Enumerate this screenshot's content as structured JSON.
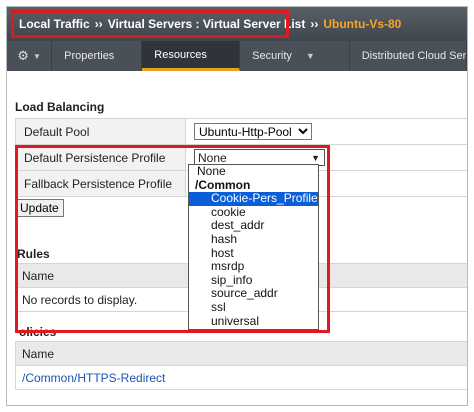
{
  "breadcrumb": {
    "items": [
      "Local Traffic",
      "Virtual Servers : Virtual Server List",
      "Ubuntu-Vs-80"
    ],
    "separator": "››"
  },
  "tabs": [
    {
      "label": "Properties",
      "active": false,
      "has_menu": false
    },
    {
      "label": "Resources",
      "active": true,
      "has_menu": false
    },
    {
      "label": "Security",
      "active": false,
      "has_menu": true
    },
    {
      "label": "Distributed Cloud Ser",
      "active": false,
      "has_menu": false
    }
  ],
  "load_balancing": {
    "title": "Load Balancing",
    "default_pool_label": "Default Pool",
    "default_pool_value": "Ubuntu-Http-Pool",
    "persistence_label": "Default Persistence Profile",
    "persistence_value": "None",
    "fallback_label": "Fallback Persistence Profile",
    "update_label": "Update"
  },
  "persistence_dropdown": {
    "options": [
      {
        "label": "None",
        "type": "option"
      },
      {
        "label": "/Common",
        "type": "group"
      },
      {
        "label": "Cookie-Pers_Profile",
        "type": "option",
        "selected": true
      },
      {
        "label": "cookie",
        "type": "option"
      },
      {
        "label": "dest_addr",
        "type": "option"
      },
      {
        "label": "hash",
        "type": "option"
      },
      {
        "label": "host",
        "type": "option"
      },
      {
        "label": "msrdp",
        "type": "option"
      },
      {
        "label": "sip_info",
        "type": "option"
      },
      {
        "label": "source_addr",
        "type": "option"
      },
      {
        "label": "ssl",
        "type": "option"
      },
      {
        "label": "universal",
        "type": "option"
      }
    ]
  },
  "rules": {
    "title": "Rules",
    "column_name": "Name",
    "empty_text": "No records to display."
  },
  "policies": {
    "title": "olicies",
    "column_name": "Name",
    "rows": [
      "/Common/HTTPS-Redirect"
    ]
  },
  "colors": {
    "highlight": "#e0191e",
    "selected": "#0a5fd8",
    "header_bg": "#4a5058",
    "active_tab_accent": "#e9a021",
    "current_crumb": "#f5a623"
  }
}
